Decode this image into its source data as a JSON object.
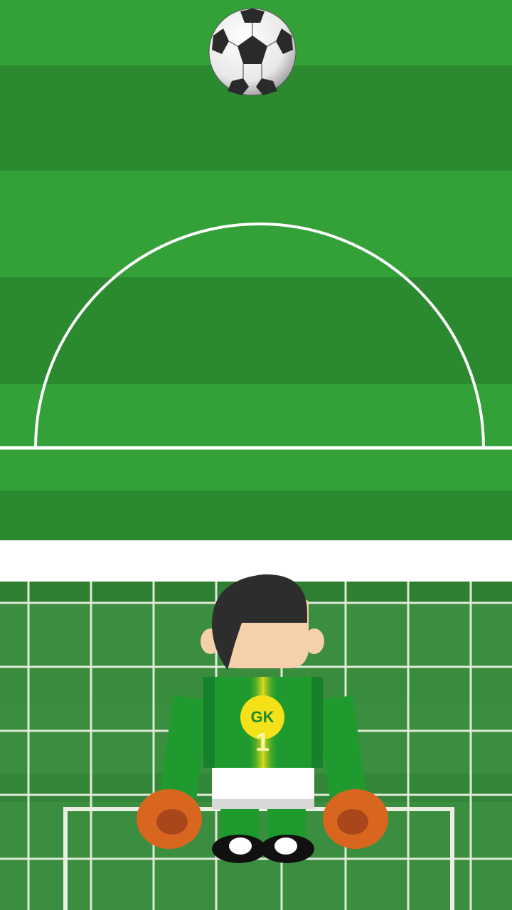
{
  "game": {
    "goalkeeper": {
      "badge_text": "GK",
      "shirt_number": "1"
    },
    "colors": {
      "pitch_light": "#34a038",
      "pitch_dark": "#2b8a2f",
      "lines": "#ffffff",
      "keeper_shirt": "#1f9a2e",
      "keeper_gloves": "#d9661f",
      "badge": "#f4e118"
    },
    "icons": {
      "ball": "soccer-ball-icon"
    }
  }
}
